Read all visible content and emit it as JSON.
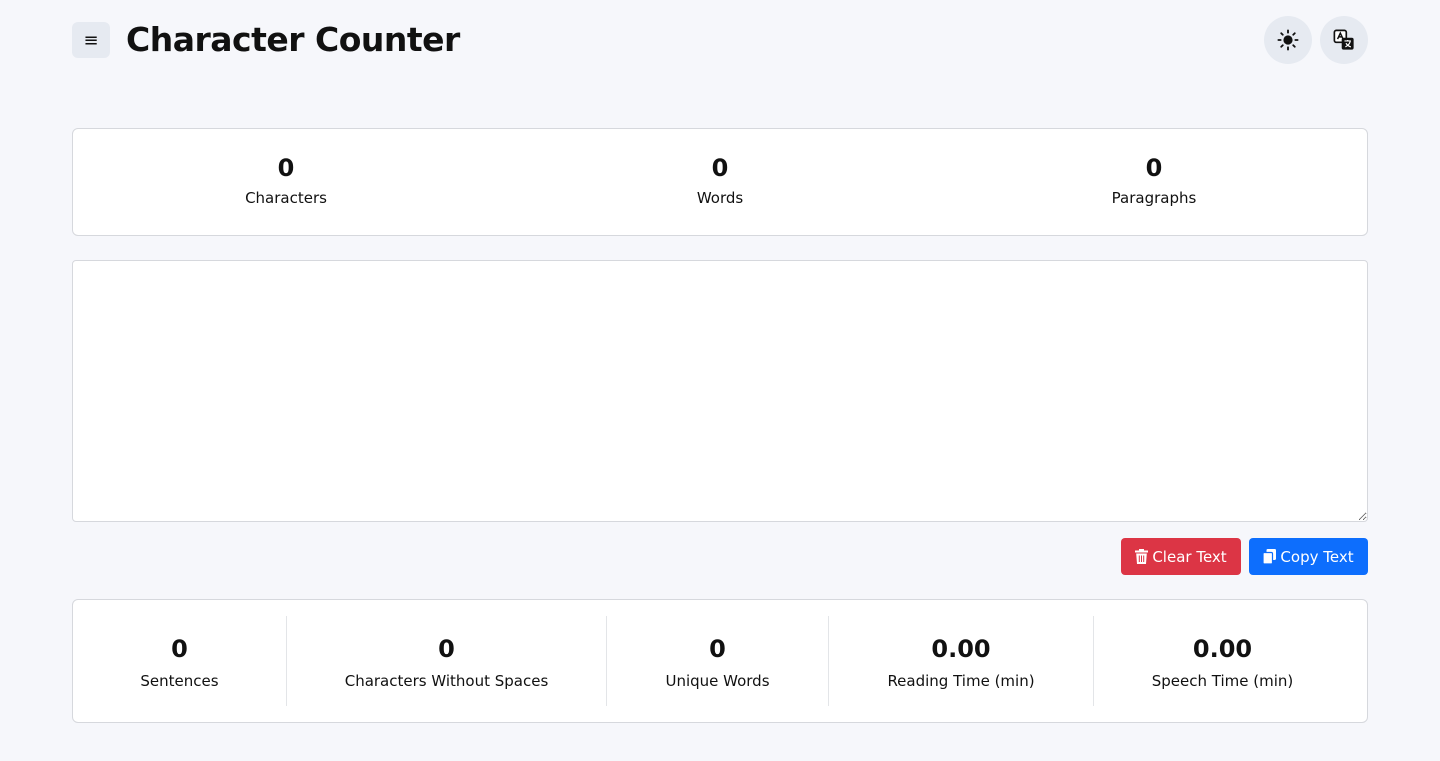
{
  "header": {
    "title": "Character Counter",
    "menu_icon": "≡",
    "theme_icon": "sun-icon",
    "language_icon": "translate-icon"
  },
  "top_stats": [
    {
      "value": "0",
      "label": "Characters"
    },
    {
      "value": "0",
      "label": "Words"
    },
    {
      "value": "0",
      "label": "Paragraphs"
    }
  ],
  "editor": {
    "value": "",
    "placeholder": ""
  },
  "actions": {
    "clear_label": "Clear Text",
    "copy_label": "Copy Text"
  },
  "bottom_stats": [
    {
      "value": "0",
      "label": "Sentences"
    },
    {
      "value": "0",
      "label": "Characters Without Spaces"
    },
    {
      "value": "0",
      "label": "Unique Words"
    },
    {
      "value": "0.00",
      "label": "Reading Time (min)"
    },
    {
      "value": "0.00",
      "label": "Speech Time (min)"
    }
  ],
  "colors": {
    "danger": "#dc3545",
    "primary": "#0d6efd",
    "background": "#f6f7fb"
  }
}
